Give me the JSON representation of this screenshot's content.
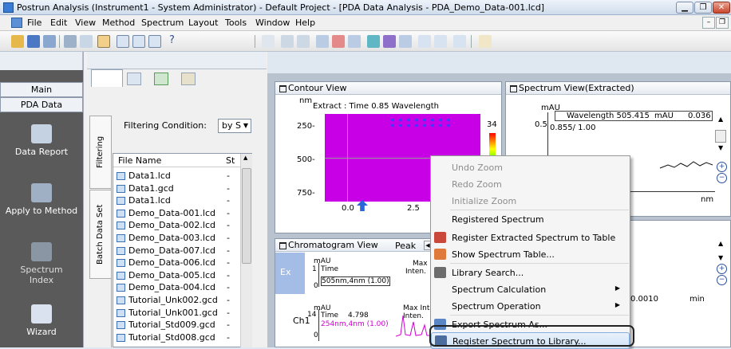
{
  "window": {
    "title": "Postrun Analysis (Instrument1 - System Administrator) - Default Project - [PDA Data Analysis - PDA_Demo_Data-001.lcd]"
  },
  "menubar": {
    "items": [
      "File",
      "Edit",
      "View",
      "Method",
      "Spectrum",
      "Layout",
      "Tools",
      "Window",
      "Help"
    ]
  },
  "leftnav": {
    "tab_main": "Main",
    "tab_pda": "PDA Data",
    "buttons": [
      "Data Report",
      "Apply to Method",
      "Spectrum Index",
      "Wizard"
    ]
  },
  "datapanel": {
    "filtering_label": "Filtering Condition:",
    "filtering_value": "by S",
    "vtab_filtering": "Filtering",
    "vtab_batch": "Batch Data Set",
    "col_filename": "File Name",
    "col_status": "St",
    "files": [
      {
        "name": "Data1.lcd",
        "st": "-"
      },
      {
        "name": "Data1.gcd",
        "st": "-"
      },
      {
        "name": "Data1.lcd",
        "st": "-"
      },
      {
        "name": "Demo_Data-001.lcd",
        "st": "-"
      },
      {
        "name": "Demo_Data-002.lcd",
        "st": "-"
      },
      {
        "name": "Demo_Data-003.lcd",
        "st": "-"
      },
      {
        "name": "Demo_Data-007.lcd",
        "st": "-"
      },
      {
        "name": "Demo_Data-006.lcd",
        "st": "-"
      },
      {
        "name": "Demo_Data-005.lcd",
        "st": "-"
      },
      {
        "name": "Demo_Data-004.lcd",
        "st": "-"
      },
      {
        "name": "Tutorial_Unk002.gcd",
        "st": "-"
      },
      {
        "name": "Tutorial_Unk001.gcd",
        "st": "-"
      },
      {
        "name": "Tutorial_Std009.gcd",
        "st": "-"
      },
      {
        "name": "Tutorial_Std008.gcd",
        "st": "-"
      }
    ]
  },
  "contour": {
    "title": "Contour View",
    "unit": "nm",
    "extract_text": "Extract : Time  0.85   Wavelength",
    "y_ticks": [
      "250-",
      "500-",
      "750-"
    ],
    "x_ticks": [
      "0.0",
      "2.5"
    ],
    "scale_value": "34"
  },
  "spectrum": {
    "title": "Spectrum View(Extracted)",
    "unit": "mAU",
    "wavelength_text": "Wavelength  505.415",
    "mau_text": "mAU",
    "value_text": "0.036",
    "y_tick": "0.5",
    "legend_text": "0.855/ 1.00",
    "x_tick": "0",
    "x_unit": "nm"
  },
  "spectrum2": {
    "x_tick": "0.0010",
    "x_unit": "min"
  },
  "chromatogram": {
    "title": "Chromatogram View",
    "peak_label": "Peak",
    "ex_label": "Ex",
    "ch1_label": "Ch1",
    "unit": "mAU",
    "y_tick1": "1",
    "y_tick2": "14",
    "y_tick0": "0",
    "row1": {
      "time": "Time",
      "max": "Max",
      "inten": "Inten.",
      "wave": "505nm,4nm (1.00)"
    },
    "row2": {
      "time": "Time",
      "timeval": "4.798",
      "max": "Max Int",
      "inten": "Inten.",
      "wave": "254nm,4nm (1.00)"
    }
  },
  "context_menu": {
    "items": [
      {
        "label": "Undo Zoom",
        "disabled": true
      },
      {
        "label": "Redo Zoom",
        "disabled": true
      },
      {
        "label": "Initialize Zoom",
        "disabled": true
      },
      {
        "label": "Registered Spectrum",
        "disabled": false
      },
      {
        "label": "Register Extracted Spectrum to Table",
        "disabled": false
      },
      {
        "label": "Show Spectrum Table...",
        "disabled": false
      },
      {
        "label": "Library Search...",
        "disabled": false
      },
      {
        "label": "Spectrum Calculation",
        "disabled": false,
        "submenu": true
      },
      {
        "label": "Spectrum Operation",
        "disabled": false,
        "submenu": true
      },
      {
        "label": "Export Spectrum As...",
        "disabled": false
      },
      {
        "label": "Register Spectrum to Library...",
        "disabled": false,
        "selected": true
      }
    ]
  },
  "colors": {
    "contour_bg": "#c800e6",
    "menu_select": "#cfe2f7",
    "nav_bg": "#5a5a5a"
  },
  "symbols": {
    "help": "?"
  }
}
